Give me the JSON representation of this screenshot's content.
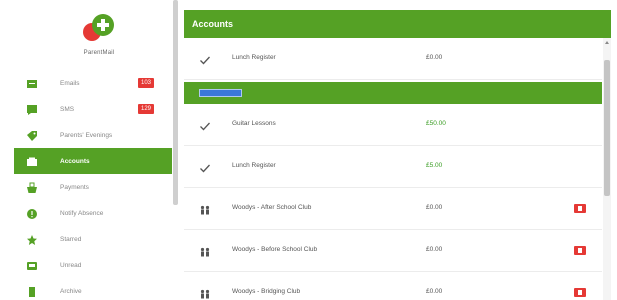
{
  "app": {
    "logo_text": "ParentMail"
  },
  "sidebar": {
    "items": [
      {
        "label": "Emails",
        "badge": "103",
        "icon": "mail-icon",
        "active": false
      },
      {
        "label": "SMS",
        "badge": "129",
        "icon": "message-icon",
        "active": false
      },
      {
        "label": "Parents' Evenings",
        "badge": "",
        "icon": "tag-icon",
        "active": false
      },
      {
        "label": "Accounts",
        "badge": "",
        "icon": "wallet-icon",
        "active": true
      },
      {
        "label": "Payments",
        "badge": "",
        "icon": "basket-icon",
        "active": false
      },
      {
        "label": "Notify Absence",
        "badge": "",
        "icon": "alert-icon",
        "active": false
      },
      {
        "label": "Starred",
        "badge": "",
        "icon": "star-icon",
        "active": false
      },
      {
        "label": "Unread",
        "badge": "",
        "icon": "inbox-icon",
        "active": false
      },
      {
        "label": "Archive",
        "badge": "",
        "icon": "archive-icon",
        "active": false
      }
    ]
  },
  "main": {
    "title": "Accounts",
    "rows_top": [
      {
        "status": "check-icon",
        "name": "Lunch Register",
        "amount": "£0.00",
        "green": false,
        "delete": false
      }
    ],
    "rows_bottom": [
      {
        "status": "check-icon",
        "name": "Guitar Lessons",
        "amount": "£50.00",
        "green": true,
        "delete": false
      },
      {
        "status": "check-icon",
        "name": "Lunch Register",
        "amount": "£5.00",
        "green": true,
        "delete": false
      },
      {
        "status": "children-icon",
        "name": "Woodys - After School Club",
        "amount": "£0.00",
        "green": false,
        "delete": true
      },
      {
        "status": "children-icon",
        "name": "Woodys - Before School Club",
        "amount": "£0.00",
        "green": false,
        "delete": true
      },
      {
        "status": "children-icon",
        "name": "Woodys - Bridging Club",
        "amount": "£0.00",
        "green": false,
        "delete": true
      }
    ]
  },
  "colors": {
    "accent": "#55a125",
    "badge": "#e53935",
    "tag": "#3a78d8",
    "amount_green": "#3a9d23"
  }
}
